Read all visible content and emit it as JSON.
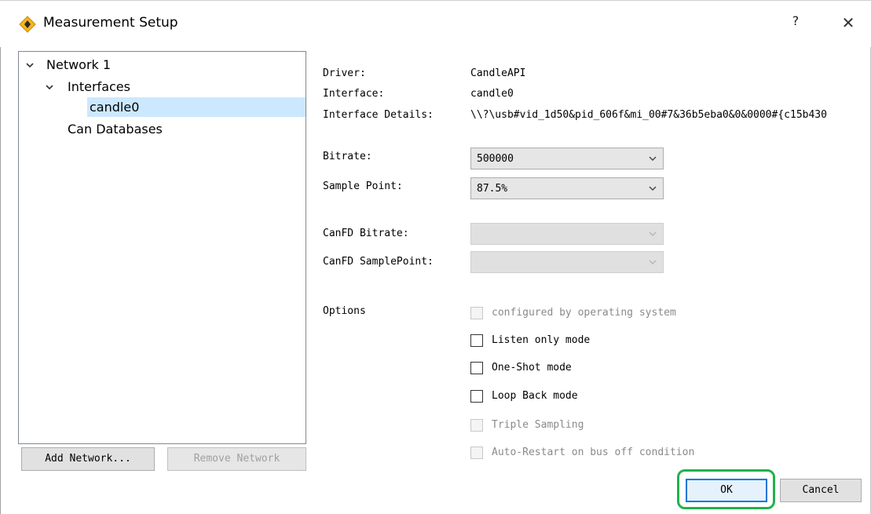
{
  "window": {
    "title": "Measurement Setup",
    "help_label": "?",
    "close_label": "✕",
    "icon": "app-diamond-icon"
  },
  "tree": {
    "network": "Network 1",
    "interfaces": "Interfaces",
    "interface_item": "candle0",
    "databases": "Can Databases"
  },
  "left_buttons": {
    "add": "Add Network...",
    "remove": "Remove Network"
  },
  "details": {
    "driver_label": "Driver:",
    "driver_value": "CandleAPI",
    "interface_label": "Interface:",
    "interface_value": "candle0",
    "details_label": "Interface Details:",
    "details_value": "\\\\?\\usb#vid_1d50&pid_606f&mi_00#7&36b5eba0&0&0000#{c15b430"
  },
  "settings": {
    "bitrate_label": "Bitrate:",
    "bitrate_value": "500000",
    "sample_point_label": "Sample Point:",
    "sample_point_value": "87.5%",
    "canfd_bitrate_label": "CanFD Bitrate:",
    "canfd_bitrate_value": "",
    "canfd_sample_label": "CanFD SamplePoint:",
    "canfd_sample_value": ""
  },
  "options": {
    "label": "Options",
    "items": [
      {
        "label": "configured by operating system",
        "checked": false,
        "enabled": false
      },
      {
        "label": "Listen only mode",
        "checked": false,
        "enabled": true
      },
      {
        "label": "One-Shot mode",
        "checked": false,
        "enabled": true
      },
      {
        "label": "Loop Back mode",
        "checked": false,
        "enabled": true
      },
      {
        "label": "Triple Sampling",
        "checked": false,
        "enabled": false
      },
      {
        "label": "Auto-Restart on bus off condition",
        "checked": false,
        "enabled": false
      }
    ]
  },
  "footer": {
    "ok": "OK",
    "cancel": "Cancel"
  },
  "colors": {
    "selection": "#cce8ff",
    "highlight": "#22b14c",
    "default_button_border": "#0078d7"
  }
}
